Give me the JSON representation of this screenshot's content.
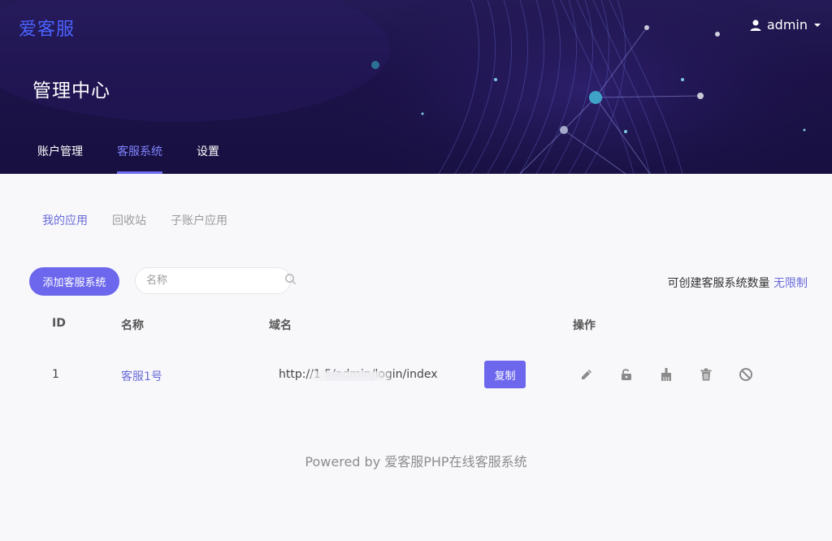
{
  "app": {
    "brand": "爱客服",
    "page_title": "管理中心",
    "user_name": "admin"
  },
  "nav": {
    "tabs": [
      {
        "label": "账户管理",
        "active": false
      },
      {
        "label": "客服系统",
        "active": true
      },
      {
        "label": "设置",
        "active": false
      }
    ]
  },
  "subnav": {
    "tabs": [
      {
        "label": "我的应用",
        "active": true
      },
      {
        "label": "回收站",
        "active": false
      },
      {
        "label": "子账户应用",
        "active": false
      }
    ]
  },
  "toolbar": {
    "add_label": "添加客服系统",
    "search_placeholder": "名称",
    "quota_label": "可创建客服系统数量",
    "quota_value": "无限制"
  },
  "table": {
    "headers": {
      "id": "ID",
      "name": "名称",
      "domain": "域名",
      "ops": "操作"
    },
    "rows": [
      {
        "id": "1",
        "name": "客服1号",
        "domain": "http://1          5/admin/login/index",
        "copy_label": "复制"
      }
    ]
  },
  "icons": {
    "user": "user-icon",
    "caret": "caret-down-icon",
    "search": "search-icon",
    "edit": "pencil-icon",
    "unlock": "unlock-icon",
    "clean": "brush-icon",
    "delete": "trash-icon",
    "disable": "ban-icon"
  },
  "colors": {
    "accent": "#6c67ec",
    "brand": "#4a63ff",
    "header_bg": "#1c1248"
  },
  "footer": {
    "text": "Powered by 爱客服PHP在线客服系统"
  }
}
